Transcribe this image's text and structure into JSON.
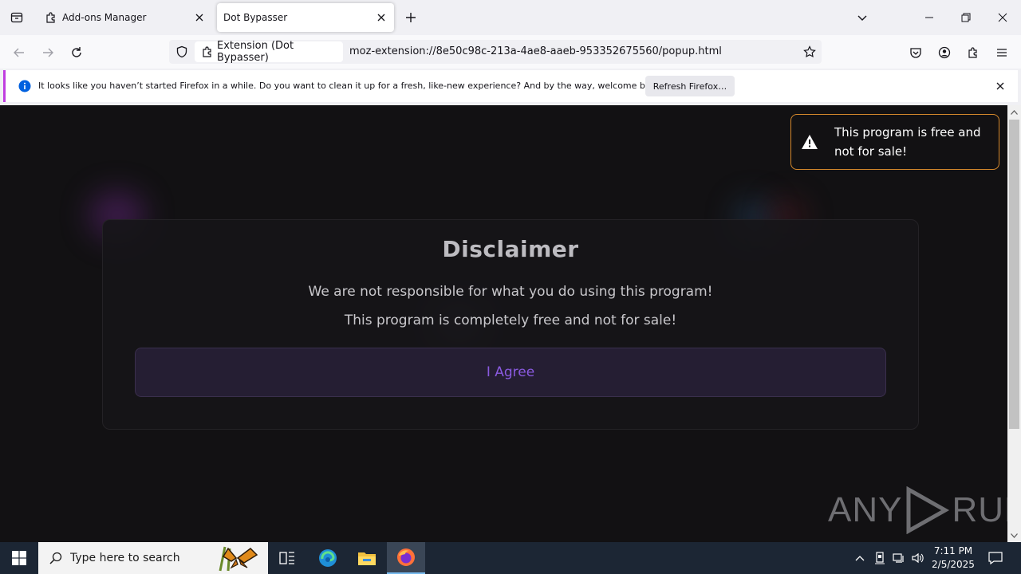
{
  "tabs": [
    {
      "label": "Add-ons Manager",
      "icon": "puzzle-icon"
    },
    {
      "label": "Dot Bypasser",
      "icon": ""
    }
  ],
  "navbar": {
    "identity_label": "Extension (Dot Bypasser)",
    "url": "moz-extension://8e50c98c-213a-4ae8-aaeb-953352675560/popup.html"
  },
  "notification": {
    "message": "It looks like you haven’t started Firefox in a while. Do you want to clean it up for a fresh, like-new experience? And by the way, welcome back!",
    "button_label": "Refresh Firefox…"
  },
  "toast": {
    "message": "This program is free and not for sale!",
    "border_color": "#d4882c"
  },
  "disclaimer": {
    "title": "Disclaimer",
    "line1": "We are not responsible for what you do using this program!",
    "line2": "This program is completely free and not for sale!",
    "agree_label": "I Agree",
    "accent_color": "#8a5ae0"
  },
  "watermark": {
    "text_left": "ANY",
    "text_right": "RUN"
  },
  "taskbar": {
    "search_placeholder": "Type here to search",
    "time": "7:11 PM",
    "date": "2/5/2025"
  }
}
